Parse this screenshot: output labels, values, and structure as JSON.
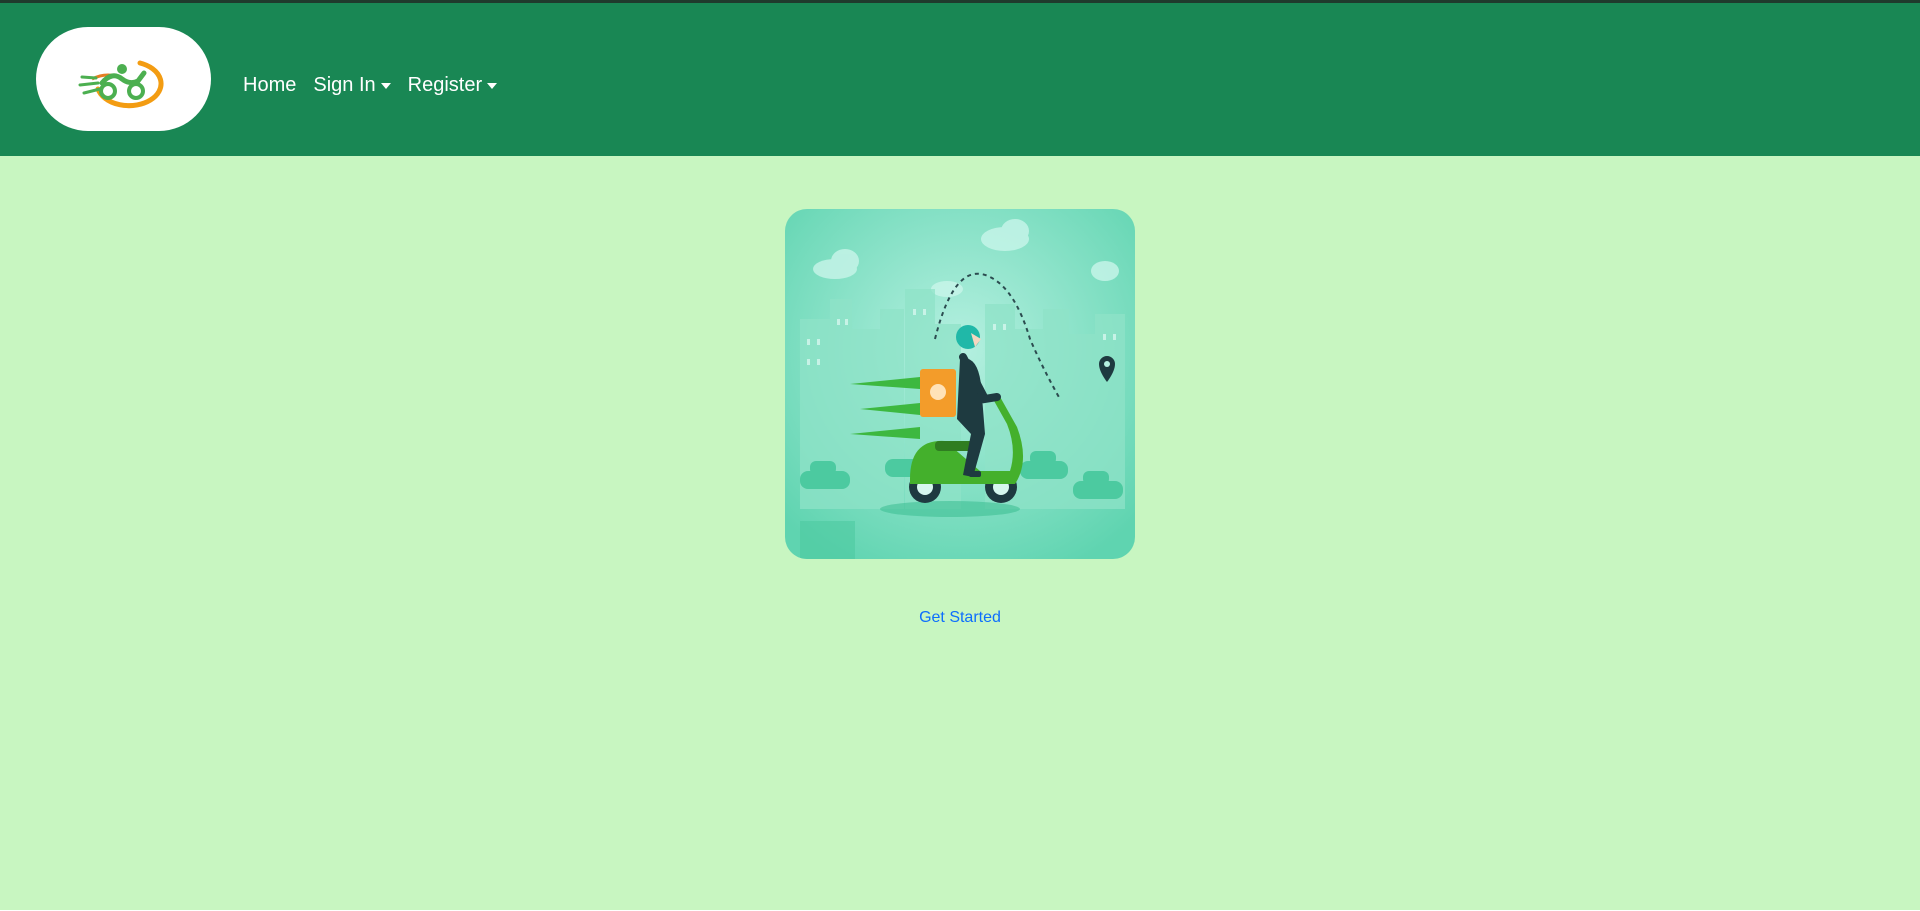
{
  "navbar": {
    "logo_icon": "delivery-scooter-logo",
    "links": [
      {
        "label": "Home",
        "dropdown": false
      },
      {
        "label": "Sign In",
        "dropdown": true
      },
      {
        "label": "Register",
        "dropdown": true
      }
    ]
  },
  "hero": {
    "illustration": "delivery-rider-on-scooter"
  },
  "cta": {
    "label": "Get Started"
  },
  "colors": {
    "navbar_bg": "#198754",
    "page_bg": "#c8f6c1",
    "link": "#0d6efd"
  }
}
